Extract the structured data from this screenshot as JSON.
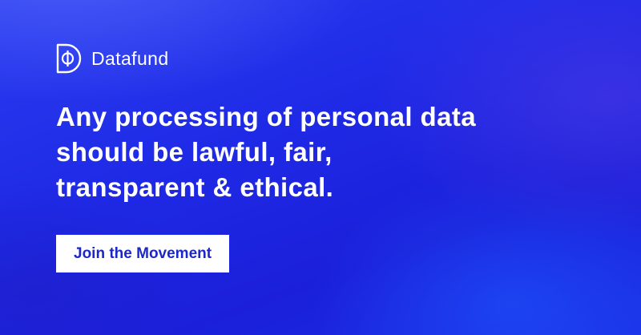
{
  "brand": {
    "name": "Datafund",
    "logo_icon": "datafund-logo-icon"
  },
  "headline": {
    "lines": [
      "Any processing of personal data",
      "should be lawful, fair,",
      "transparent & ethical."
    ]
  },
  "cta": {
    "label": "Join the Movement"
  },
  "colors": {
    "background": "#1f2ae6",
    "text": "#ffffff",
    "button_bg": "#ffffff",
    "button_text": "#1c27c7"
  }
}
